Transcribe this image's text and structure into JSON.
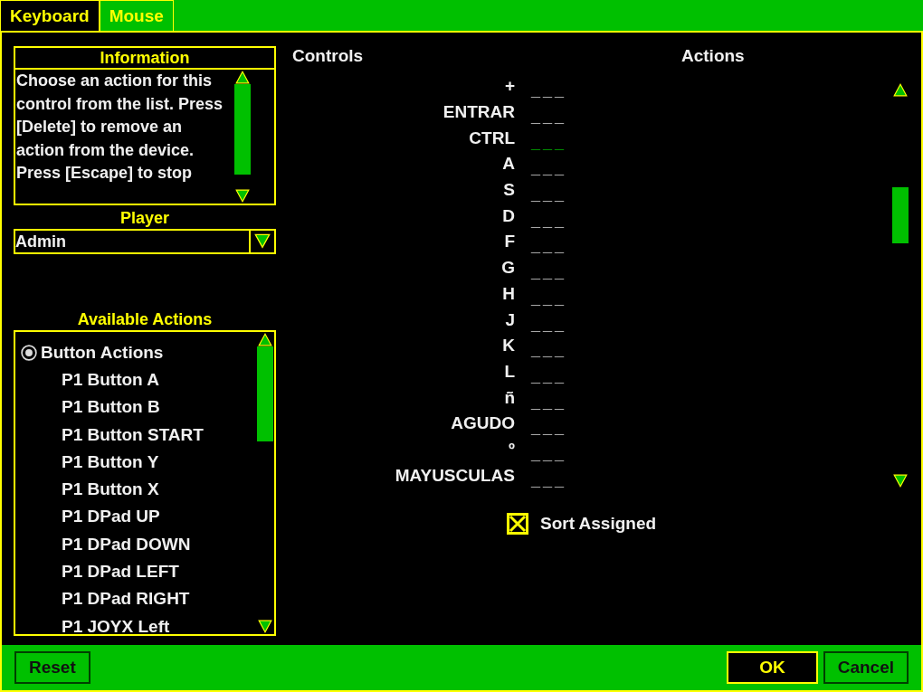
{
  "tabs": [
    {
      "label": "Keyboard",
      "selected": true
    },
    {
      "label": "Mouse",
      "selected": false
    }
  ],
  "information": {
    "title": "Information",
    "text": "Choose an action for this control from the list. Press [Delete] to remove an action from the device. Press [Escape] to stop"
  },
  "player": {
    "label": "Player",
    "value": "Admin"
  },
  "available_actions": {
    "title": "Available Actions",
    "group": {
      "label": "Button Actions",
      "selected": true
    },
    "items": [
      "P1 Button A",
      "P1 Button B",
      "P1 Button START",
      "P1 Button Y",
      "P1 Button X",
      "P1 DPad UP",
      "P1 DPad DOWN",
      "P1 DPad LEFT",
      "P1 DPad RIGHT",
      "P1 JOYX Left"
    ]
  },
  "columns": [
    "Controls",
    "Actions"
  ],
  "controls": [
    {
      "name": "+",
      "action": "___",
      "selected": false
    },
    {
      "name": "ENTRAR",
      "action": "___",
      "selected": false
    },
    {
      "name": "CTRL",
      "action": "___",
      "selected": true
    },
    {
      "name": "A",
      "action": "___",
      "selected": false
    },
    {
      "name": "S",
      "action": "___",
      "selected": false
    },
    {
      "name": "D",
      "action": "___",
      "selected": false
    },
    {
      "name": "F",
      "action": "___",
      "selected": false
    },
    {
      "name": "G",
      "action": "___",
      "selected": false
    },
    {
      "name": "H",
      "action": "___",
      "selected": false
    },
    {
      "name": "J",
      "action": "___",
      "selected": false
    },
    {
      "name": "K",
      "action": "___",
      "selected": false
    },
    {
      "name": "L",
      "action": "___",
      "selected": false
    },
    {
      "name": "ñ",
      "action": "___",
      "selected": false
    },
    {
      "name": "AGUDO",
      "action": "___",
      "selected": false
    },
    {
      "name": "º",
      "action": "___",
      "selected": false
    },
    {
      "name": "MAYUSCULAS",
      "action": "___",
      "selected": false
    }
  ],
  "sort_assigned": {
    "label": "Sort Assigned",
    "checked": true
  },
  "buttons": [
    {
      "label": "Reset",
      "kind": "plain"
    },
    {
      "label": "OK",
      "kind": "default"
    },
    {
      "label": "Cancel",
      "kind": "plain"
    }
  ]
}
